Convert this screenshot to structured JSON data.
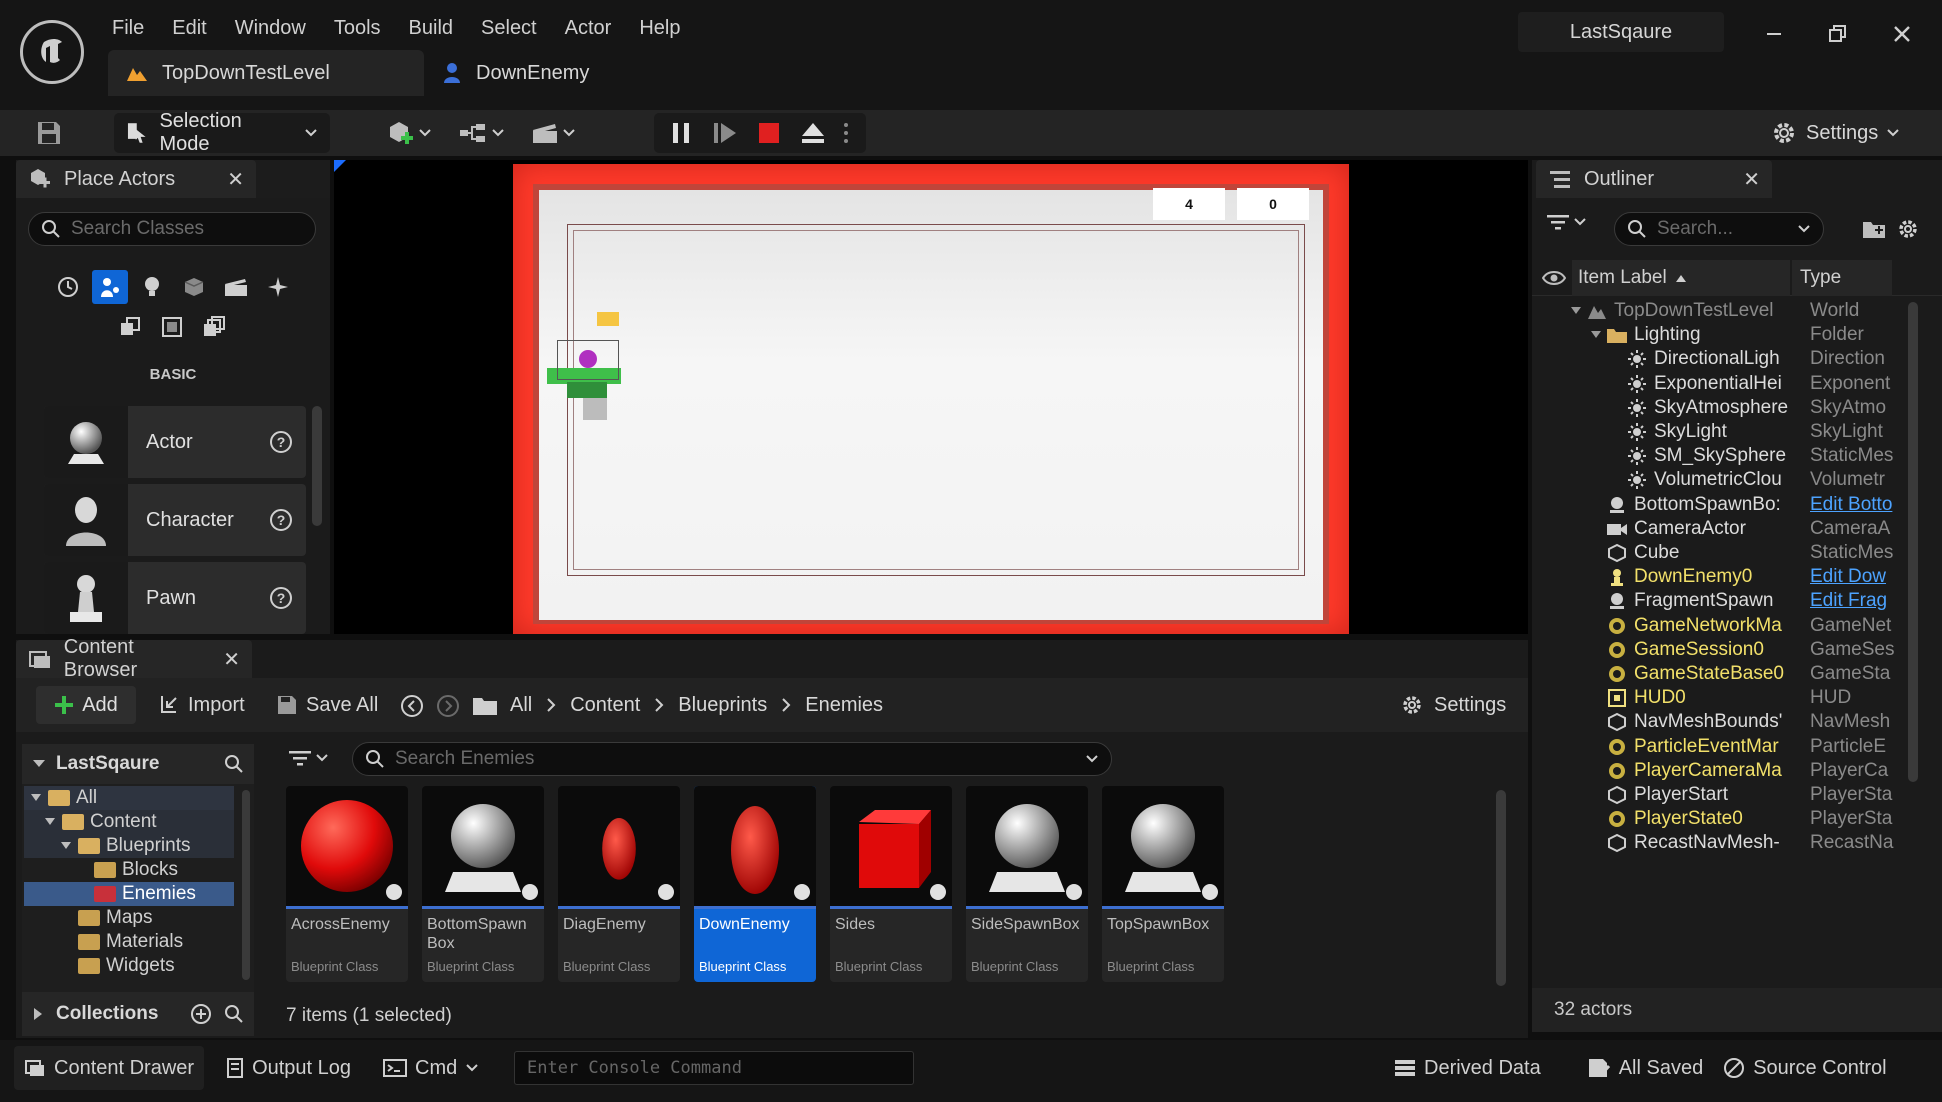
{
  "menu": [
    "File",
    "Edit",
    "Window",
    "Tools",
    "Build",
    "Select",
    "Actor",
    "Help"
  ],
  "project_name": "LastSqaure",
  "tabs": [
    {
      "label": "TopDownTestLevel",
      "active": true
    },
    {
      "label": "DownEnemy",
      "active": false
    }
  ],
  "toolbar": {
    "mode_label": "Selection Mode",
    "settings_label": "Settings"
  },
  "place_actors": {
    "title": "Place Actors",
    "search_placeholder": "Search Classes",
    "category": "BASIC",
    "items": [
      "Actor",
      "Character",
      "Pawn"
    ]
  },
  "viewport": {
    "score_left": "4",
    "score_right": "0"
  },
  "outliner": {
    "title": "Outliner",
    "search_placeholder": "Search...",
    "col_label": "Item Label",
    "col_type": "Type",
    "rows": [
      {
        "label": "TopDownTestLevel",
        "type": "World",
        "indent": 0,
        "color": "dim",
        "link": false
      },
      {
        "label": "Lighting",
        "type": "Folder",
        "indent": 1,
        "color": "white",
        "link": false
      },
      {
        "label": "DirectionalLigh",
        "type": "Direction",
        "indent": 2,
        "color": "white",
        "link": false
      },
      {
        "label": "ExponentialHei",
        "type": "Exponent",
        "indent": 2,
        "color": "white",
        "link": false
      },
      {
        "label": "SkyAtmosphere",
        "type": "SkyAtmo",
        "indent": 2,
        "color": "white",
        "link": false
      },
      {
        "label": "SkyLight",
        "type": "SkyLight",
        "indent": 2,
        "color": "white",
        "link": false
      },
      {
        "label": "SM_SkySphere",
        "type": "StaticMes",
        "indent": 2,
        "color": "white",
        "link": false
      },
      {
        "label": "VolumetricClou",
        "type": "Volumetr",
        "indent": 2,
        "color": "white",
        "link": false
      },
      {
        "label": "BottomSpawnBo:",
        "type": "Edit Botto",
        "indent": 1,
        "color": "white",
        "link": true
      },
      {
        "label": "CameraActor",
        "type": "CameraA",
        "indent": 1,
        "color": "white",
        "link": false
      },
      {
        "label": "Cube",
        "type": "StaticMes",
        "indent": 1,
        "color": "white",
        "link": false
      },
      {
        "label": "DownEnemy0",
        "type": "Edit Dow",
        "indent": 1,
        "color": "yellow",
        "link": true
      },
      {
        "label": "FragmentSpawn",
        "type": "Edit Frag",
        "indent": 1,
        "color": "white",
        "link": true
      },
      {
        "label": "GameNetworkMa",
        "type": "GameNet",
        "indent": 1,
        "color": "yellow",
        "link": false
      },
      {
        "label": "GameSession0",
        "type": "GameSes",
        "indent": 1,
        "color": "yellow",
        "link": false
      },
      {
        "label": "GameStateBase0",
        "type": "GameSta",
        "indent": 1,
        "color": "yellow",
        "link": false
      },
      {
        "label": "HUD0",
        "type": "HUD",
        "indent": 1,
        "color": "yellow",
        "link": false
      },
      {
        "label": "NavMeshBounds'",
        "type": "NavMesh",
        "indent": 1,
        "color": "white",
        "link": false
      },
      {
        "label": "ParticleEventMar",
        "type": "ParticleE",
        "indent": 1,
        "color": "yellow",
        "link": false
      },
      {
        "label": "PlayerCameraMa",
        "type": "PlayerCa",
        "indent": 1,
        "color": "yellow",
        "link": false
      },
      {
        "label": "PlayerStart",
        "type": "PlayerSta",
        "indent": 1,
        "color": "white",
        "link": false
      },
      {
        "label": "PlayerState0",
        "type": "PlayerSta",
        "indent": 1,
        "color": "yellow",
        "link": false
      },
      {
        "label": "RecastNavMesh-",
        "type": "RecastNa",
        "indent": 1,
        "color": "white",
        "link": false
      }
    ],
    "actor_count": "32 actors"
  },
  "content_browser": {
    "title": "Content Browser",
    "add_label": "Add",
    "import_label": "Import",
    "save_all_label": "Save All",
    "settings_label": "Settings",
    "breadcrumb": [
      "All",
      "Content",
      "Blueprints",
      "Enemies"
    ],
    "root": "LastSqaure",
    "tree": [
      "All",
      "Content",
      "Blueprints",
      "Blocks",
      "Enemies",
      "Maps",
      "Materials",
      "Widgets"
    ],
    "collections_label": "Collections",
    "search_placeholder": "Search Enemies",
    "items_status": "7 items (1 selected)",
    "assets": [
      {
        "name": "AcrossEnemy",
        "class": "Blueprint Class",
        "thumb": "red-sphere"
      },
      {
        "name": "BottomSpawn Box",
        "class": "Blueprint Class",
        "thumb": "grey-sphere"
      },
      {
        "name": "DiagEnemy",
        "class": "Blueprint Class",
        "thumb": "red-capsule"
      },
      {
        "name": "DownEnemy",
        "class": "Blueprint Class",
        "thumb": "red-capsule"
      },
      {
        "name": "Sides",
        "class": "Blueprint Class",
        "thumb": "red-cube"
      },
      {
        "name": "SideSpawnBox",
        "class": "Blueprint Class",
        "thumb": "grey-sphere"
      },
      {
        "name": "TopSpawnBox",
        "class": "Blueprint Class",
        "thumb": "grey-sphere"
      }
    ]
  },
  "statusbar": {
    "content_drawer": "Content Drawer",
    "output_log": "Output Log",
    "cmd": "Cmd",
    "console_placeholder": "Enter Console Command",
    "derived_data": "Derived Data",
    "all_saved": "All Saved",
    "source_control": "Source Control"
  },
  "colors": {
    "accent": "#0f66d6",
    "level_tab_icon": "#f0a030",
    "blueprint_tab_icon": "#3b6fd8",
    "arena_red": "#ff3a2a",
    "stop_red": "#e02020"
  }
}
